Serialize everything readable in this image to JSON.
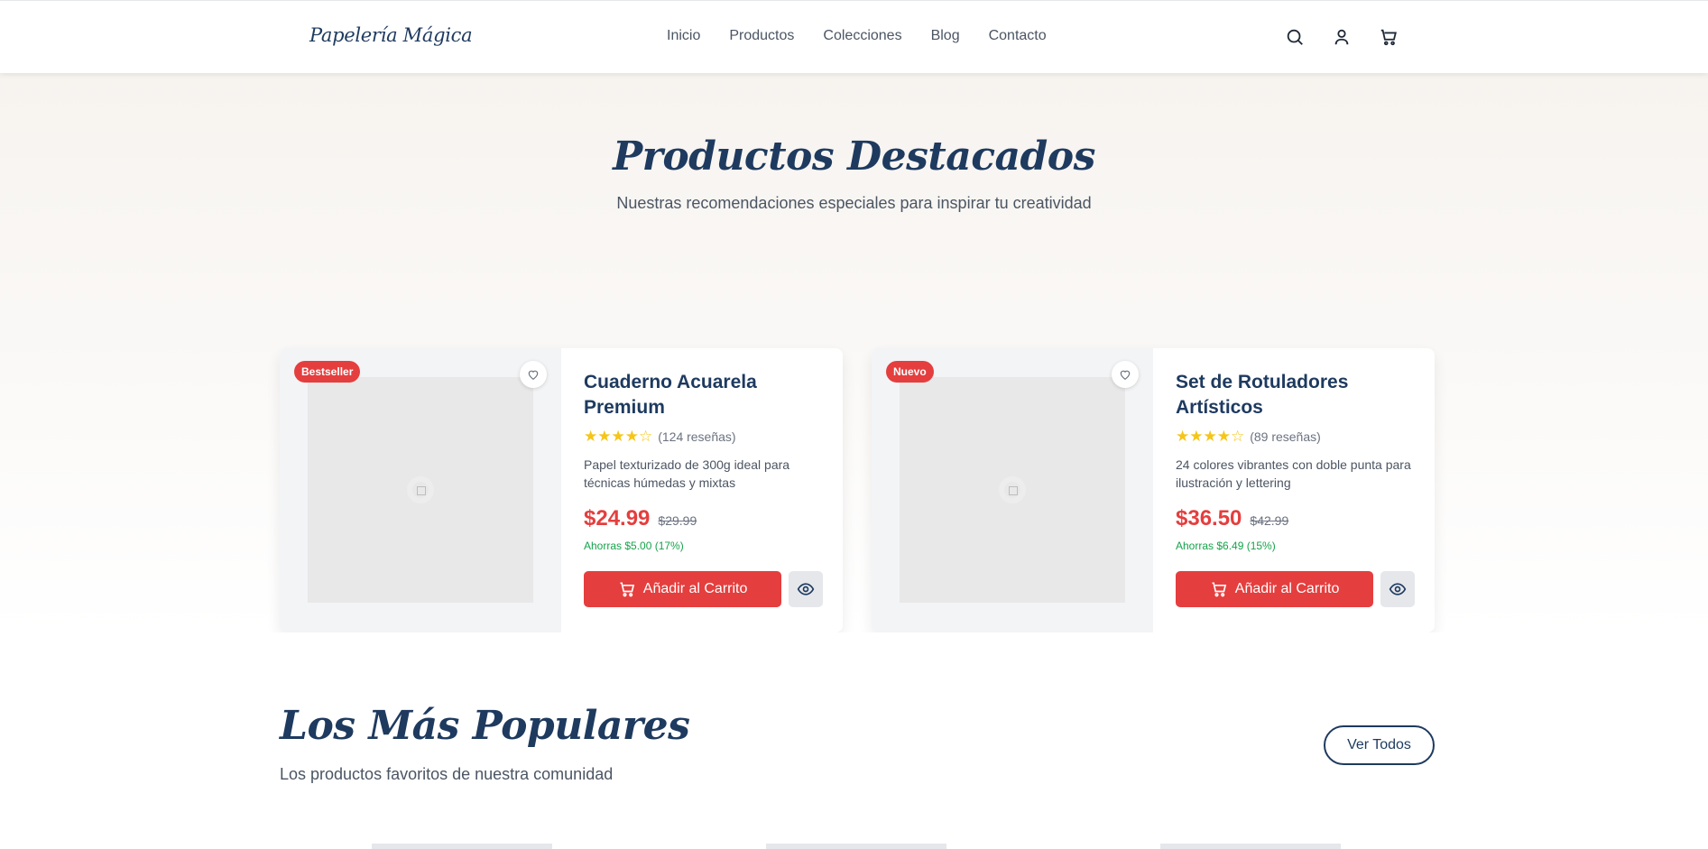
{
  "brand": {
    "logo": "Papelería Mágica"
  },
  "nav": [
    "Inicio",
    "Productos",
    "Colecciones",
    "Blog",
    "Contacto"
  ],
  "header_icons": [
    "search-icon",
    "user-icon",
    "cart-icon"
  ],
  "featured": {
    "title": "Productos Destacados",
    "subtitle": "Nuestras recomendaciones especiales para inspirar tu creatividad",
    "products": [
      {
        "badge": "Bestseller",
        "title": "Cuaderno Acuarela Premium",
        "rating": 4,
        "reviews": "(124 reseñas)",
        "description": "Papel texturizado de 300g ideal para técnicas húmedas y mixtas",
        "price": "$24.99",
        "old_price": "$29.99",
        "savings": "Ahorras $5.00 (17%)",
        "cart_label": "Añadir al Carrito"
      },
      {
        "badge": "Nuevo",
        "title": "Set de Rotuladores Artísticos",
        "rating": 4,
        "reviews": "(89 reseñas)",
        "description": "24 colores vibrantes con doble punta para ilustración y lettering",
        "price": "$36.50",
        "old_price": "$42.99",
        "savings": "Ahorras $6.49 (15%)",
        "cart_label": "Añadir al Carrito"
      }
    ]
  },
  "popular": {
    "title": "Los Más Populares",
    "subtitle": "Los productos favoritos de nuestra comunidad",
    "view_all": "Ver Todos"
  },
  "colors": {
    "accent": "#e53e3e",
    "primary": "#1e3a5f",
    "success": "#16a34a",
    "star": "#f5c518"
  }
}
